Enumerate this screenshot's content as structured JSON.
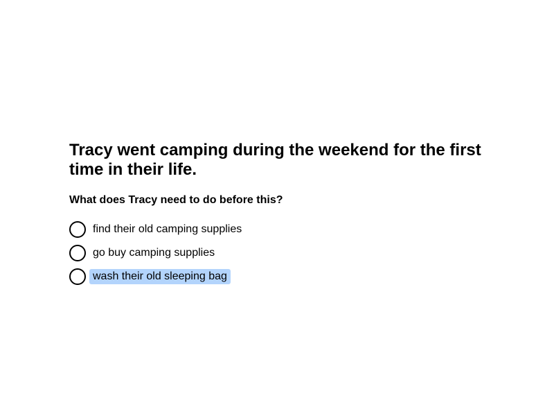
{
  "story": "Tracy went camping during the weekend for the first time in their life.",
  "question": "What does Tracy need to do before this?",
  "options": [
    {
      "label": "find their old camping supplies",
      "selected": false,
      "highlighted": false
    },
    {
      "label": "go buy camping supplies",
      "selected": false,
      "highlighted": false
    },
    {
      "label": "wash their old sleeping bag",
      "selected": false,
      "highlighted": true
    }
  ],
  "colors": {
    "highlight": "#b3d4fc",
    "text": "#000000",
    "background": "#ffffff"
  }
}
